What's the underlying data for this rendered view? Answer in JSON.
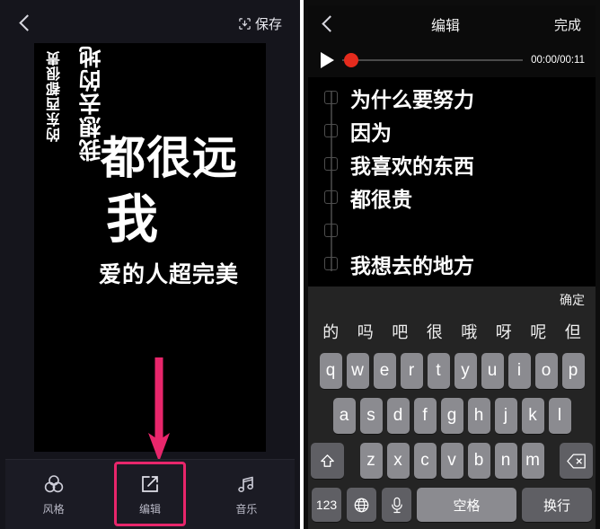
{
  "left_panel": {
    "header": {
      "back_icon": "chevron-left-icon",
      "save_label": "保存",
      "save_icon": "save-download-icon"
    },
    "poster": {
      "vertical_lines": [
        "的东西都很贵",
        "我想去的地"
      ],
      "big_lines": [
        "都很远",
        "我",
        "爱的人超完美"
      ],
      "background_color": "#000000",
      "text_color": "#ffffff"
    },
    "annotation": {
      "arrow_icon": "down-arrow-annotation",
      "arrow_color": "#e8266b",
      "highlight_color": "#e8266b",
      "highlight_target": "编辑"
    },
    "tabs": [
      {
        "label": "风格",
        "icon": "three-circles-style-icon"
      },
      {
        "label": "编辑",
        "icon": "pencil-square-edit-icon"
      },
      {
        "label": "音乐",
        "icon": "music-note-icon"
      }
    ]
  },
  "right_panel": {
    "header": {
      "back_icon": "chevron-left-icon",
      "title": "编辑",
      "done_label": "完成"
    },
    "player": {
      "play_icon": "play-triangle-icon",
      "time_label": "00:00/00:11",
      "progress_percent": 0,
      "handle_color": "#e52b1d"
    },
    "lyrics": [
      "为什么要努力",
      "因为",
      "我喜欢的东西",
      "都很贵",
      "",
      "我想去的地方"
    ],
    "keyboard": {
      "confirm_label": "确定",
      "candidates": [
        "的",
        "吗",
        "吧",
        "很",
        "哦",
        "呀",
        "呢",
        "但"
      ],
      "row1": [
        "q",
        "w",
        "e",
        "r",
        "t",
        "y",
        "u",
        "i",
        "o",
        "p"
      ],
      "row2": [
        "a",
        "s",
        "d",
        "f",
        "g",
        "h",
        "j",
        "k",
        "l"
      ],
      "row3": [
        "z",
        "x",
        "c",
        "v",
        "b",
        "n",
        "m"
      ],
      "shift_icon": "shift-up-arrow-icon",
      "backspace_icon": "backspace-delete-icon",
      "numeric_label": "123",
      "globe_icon": "globe-language-icon",
      "mic_icon": "microphone-icon",
      "space_label": "空格",
      "return_label": "换行"
    }
  }
}
